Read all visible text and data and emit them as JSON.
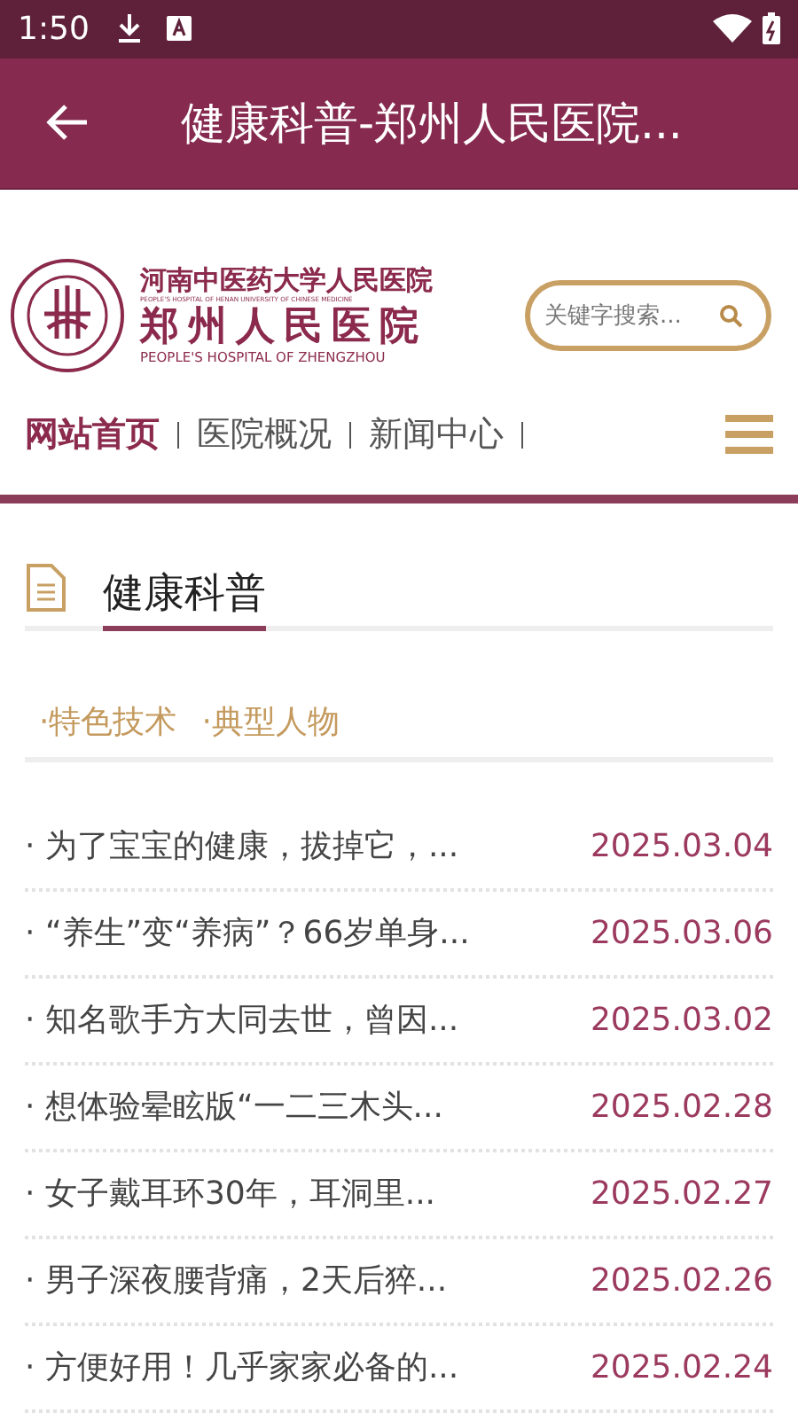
{
  "status_bar": {
    "time": "1:50"
  },
  "app_bar": {
    "title": "健康科普-郑州人民医院..."
  },
  "logo": {
    "line_1": "河南中医药大学人民医院",
    "line_2": "PEOPLE'S HOSPITAL OF HENAN UNIVERSITY OF CHINESE MEDICINE",
    "line_3": "郑州人民医院",
    "line_4": "PEOPLE'S HOSPITAL OF ZHENGZHOU"
  },
  "search": {
    "placeholder": "关键字搜索..."
  },
  "nav": [
    {
      "label": "网站首页",
      "selected": true
    },
    {
      "label": "医院概况",
      "selected": false
    },
    {
      "label": "新闻中心",
      "selected": false
    }
  ],
  "section": {
    "title": "健康科普"
  },
  "tags": [
    "·特色技术",
    "·典型人物"
  ],
  "articles": [
    {
      "title": "· 为了宝宝的健康，拔掉它，...",
      "date": "2025.03.04"
    },
    {
      "title": "· “养生”变“养病”？66岁单身...",
      "date": "2025.03.06"
    },
    {
      "title": "· 知名歌手方大同去世，曾因...",
      "date": "2025.03.02"
    },
    {
      "title": "· 想体验晕眩版“一二三木头...",
      "date": "2025.02.28"
    },
    {
      "title": "· 女子戴耳环30年，耳洞里...",
      "date": "2025.02.27"
    },
    {
      "title": "· 男子深夜腰背痛，2天后猝...",
      "date": "2025.02.26"
    },
    {
      "title": "· 方便好用！几乎家家必备的...",
      "date": "2025.02.24"
    }
  ]
}
